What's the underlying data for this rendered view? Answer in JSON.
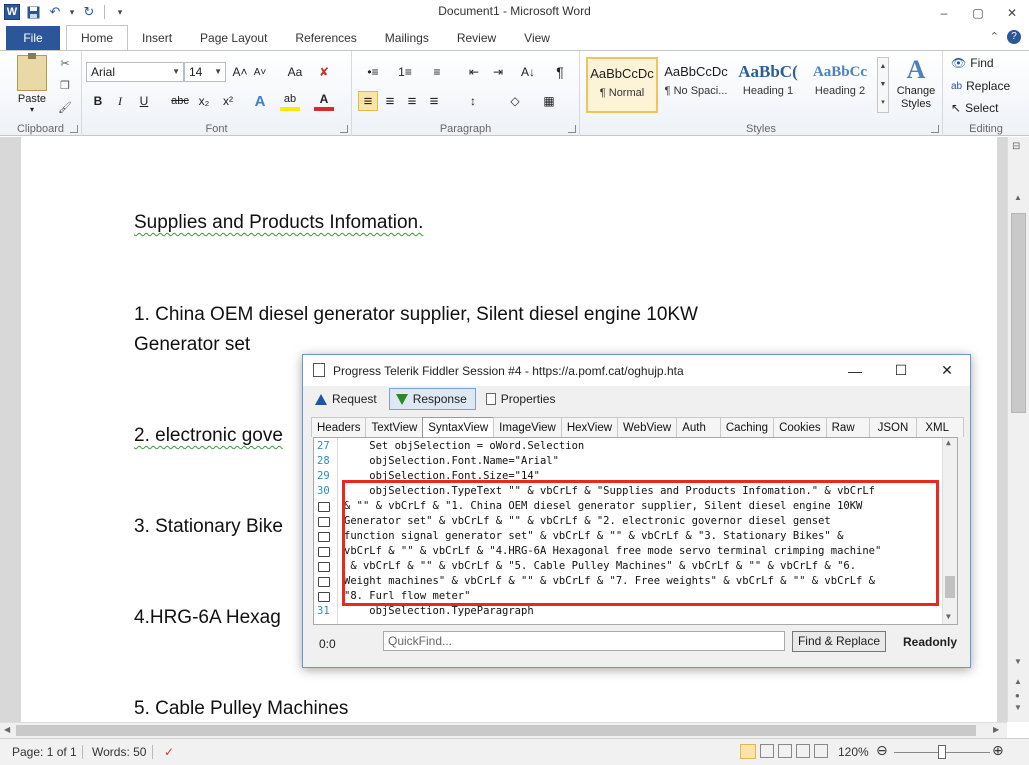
{
  "window": {
    "title": "Document1 - Microsoft Word",
    "logo_letter": "W",
    "controls": [
      "–",
      "▢",
      "✕"
    ]
  },
  "qat": {
    "save": "💾",
    "undo": "↶",
    "redo": "↻",
    "customize": "▾"
  },
  "tabs": {
    "file": "File",
    "items": [
      "Home",
      "Insert",
      "Page Layout",
      "References",
      "Mailings",
      "Review",
      "View"
    ],
    "active": "Home"
  },
  "ribbon": {
    "clipboard": {
      "label": "Clipboard",
      "paste": "Paste",
      "paste_arrow": "▾"
    },
    "font": {
      "label": "Font",
      "family": "Arial",
      "size": "14",
      "grow": "A˄",
      "shrink": "A˅",
      "case": "Aa",
      "clear": "✘",
      "bold": "B",
      "italic": "I",
      "underline": "U",
      "strike": "abc",
      "subscript": "x₂",
      "superscript": "x²",
      "effects": "A",
      "highlight": "ab",
      "color": "A"
    },
    "paragraph": {
      "label": "Paragraph",
      "bullets": "•≡",
      "numbering": "1≡",
      "multilevel": "≡",
      "dec_indent": "⇤",
      "inc_indent": "⇥",
      "sort": "A↓",
      "show": "¶",
      "align_left": "≡",
      "center": "≡",
      "align_right": "≡",
      "justify": "≡",
      "spacing": "↕",
      "shading": "◇",
      "borders": "▦"
    },
    "styles": {
      "label": "Styles",
      "items": [
        {
          "sample": "AaBbCcDc",
          "name": "¶ Normal"
        },
        {
          "sample": "AaBbCcDc",
          "name": "¶ No Spaci..."
        },
        {
          "sample": "AaBbC(",
          "name": "Heading 1"
        },
        {
          "sample": "AaBbCc",
          "name": "Heading 2"
        }
      ],
      "change_styles": "Change Styles",
      "change_styles_arrow": "▾"
    },
    "editing": {
      "label": "Editing",
      "find": "Find",
      "replace": "Replace",
      "select": "Select"
    }
  },
  "document": {
    "lines": [
      "Supplies and Products Infomation.",
      "1. China OEM diesel generator supplier, Silent diesel engine 10KW",
      "Generator set",
      "2. electronic gove",
      "3. Stationary Bike",
      "4.HRG-6A Hexag",
      "5. Cable Pulley Machines"
    ]
  },
  "statusbar": {
    "page": "Page: 1 of 1",
    "words": "Words: 50",
    "zoom": "120%",
    "zoom_out": "⊖",
    "zoom_in": "⊕"
  },
  "fiddler": {
    "title": "Progress Telerik Fiddler Session #4 - https://a.pomf.cat/oghujp.hta",
    "controls": [
      "—",
      "☐",
      "✕"
    ],
    "toolbar": {
      "request": "Request",
      "response": "Response",
      "properties": "Properties"
    },
    "tabs": [
      "Headers",
      "TextView",
      "SyntaxView",
      "ImageView",
      "HexView",
      "WebView",
      "Auth",
      "Caching",
      "Cookies",
      "Raw",
      "JSON",
      "XML"
    ],
    "active_tab": "SyntaxView",
    "code": [
      {
        "ln": "27",
        "text": "    Set objSelection = oWord.Selection"
      },
      {
        "ln": "28",
        "text": "    objSelection.Font.Name=\"Arial\""
      },
      {
        "ln": "29",
        "text": "    objSelection.Font.Size=\"14\""
      },
      {
        "ln": "30",
        "text": "    objSelection.TypeText \"\" & vbCrLf & \"Supplies and Products Infomation.\" & vbCrLf"
      },
      {
        "ln": "",
        "text": "& \"\" & vbCrLf & \"1. China OEM diesel generator supplier, Silent diesel engine 10KW"
      },
      {
        "ln": "",
        "text": "Generator set\" & vbCrLf & \"\" & vbCrLf & \"2. electronic governor diesel genset"
      },
      {
        "ln": "",
        "text": "function signal generator set\" & vbCrLf & \"\" & vbCrLf & \"3. Stationary Bikes\" &"
      },
      {
        "ln": "",
        "text": "vbCrLf & \"\" & vbCrLf & \"4.HRG-6A Hexagonal free mode servo terminal crimping machine\""
      },
      {
        "ln": "",
        "text": " & vbCrLf & \"\" & vbCrLf & \"5. Cable Pulley Machines\" & vbCrLf & \"\" & vbCrLf & \"6."
      },
      {
        "ln": "",
        "text": "Weight machines\" & vbCrLf & \"\" & vbCrLf & \"7. Free weights\" & vbCrLf & \"\" & vbCrLf &"
      },
      {
        "ln": "",
        "text": "\"8. Furl flow meter\""
      },
      {
        "ln": "31",
        "text": "    objSelection.TypeParagraph"
      }
    ],
    "position": "0:0",
    "quickfind_placeholder": "QuickFind...",
    "find_replace": "Find & Replace",
    "readonly": "Readonly"
  },
  "colors": {
    "accent": "#2b579a",
    "highlight_box": "#e8291c",
    "gutter_numbers": "#2b91af"
  }
}
